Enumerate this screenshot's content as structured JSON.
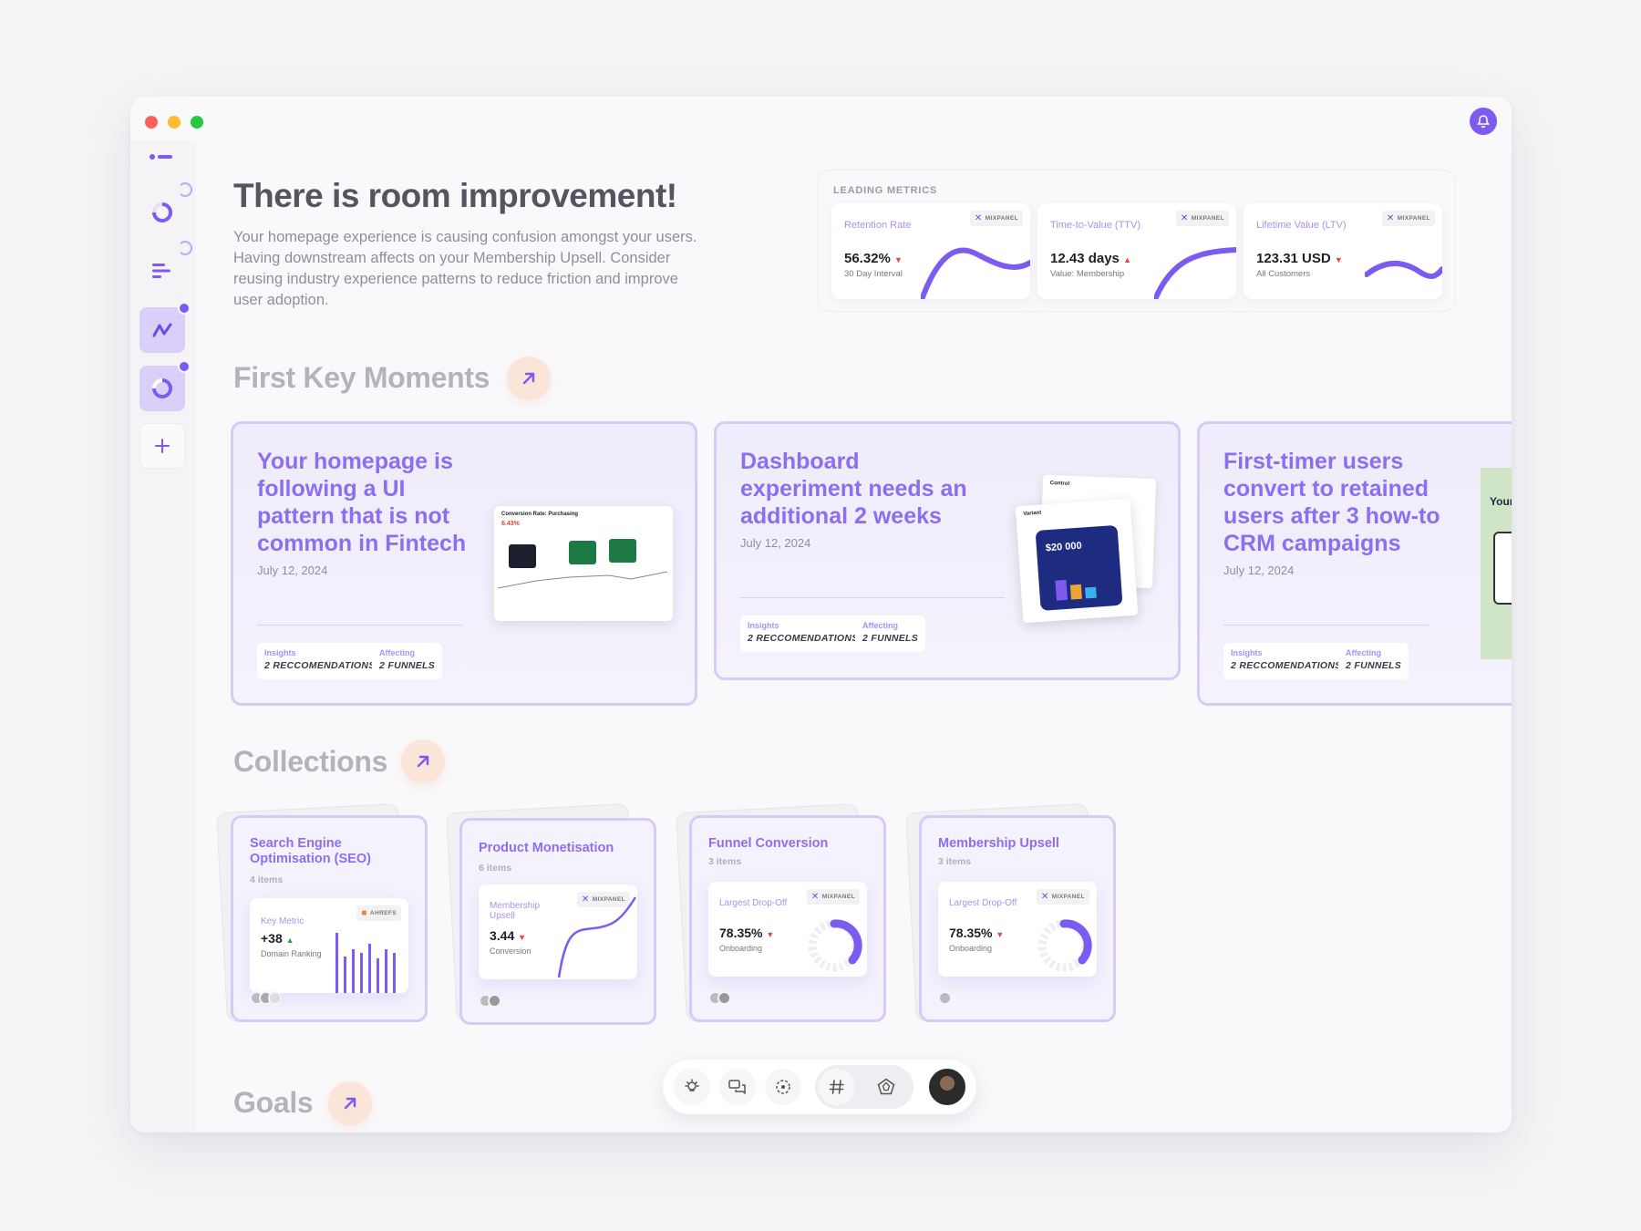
{
  "hero": {
    "title": "There is room improvement!",
    "description": "Your homepage experience is causing confusion amongst your users. Having downstream affects on your Membership Upsell. Consider reusing industry experience patterns to reduce friction and improve user adoption."
  },
  "leading_metrics": {
    "label": "LEADING METRICS",
    "cards": [
      {
        "label": "Retention Rate",
        "value": "56.32%",
        "sub": "30 Day Interval",
        "source": "MIXPANEL",
        "trend": "down"
      },
      {
        "label": "Time-to-Value (TTV)",
        "value": "12.43 days",
        "sub": "Value: Membership",
        "source": "MIXPANEL",
        "trend": "up"
      },
      {
        "label": "Lifetime Value (LTV)",
        "value": "123.31 USD",
        "sub": "All Customers",
        "source": "MIXPANEL",
        "trend": "down"
      }
    ]
  },
  "sections": {
    "first_key_moments": "First Key Moments",
    "collections": "Collections",
    "goals": "Goals"
  },
  "key_moments": [
    {
      "title": "Your homepage is following a UI pattern that is not common in Fintech",
      "date": "July 12, 2024",
      "insights_label": "Insights",
      "insights_value": "2 RECCOMENDATIONS",
      "affecting_label": "Affecting",
      "affecting_value": "2 FUNNELS",
      "preview_title": "Conversion Rate: Purchasing",
      "preview_value": "6.43%"
    },
    {
      "title": "Dashboard experiment needs an additional 2 weeks",
      "date": "July 12, 2024",
      "insights_label": "Insights",
      "insights_value": "2 RECCOMENDATIONS",
      "affecting_label": "Affecting",
      "affecting_value": "2 FUNNELS",
      "preview_control": "Control",
      "preview_variant": "Variant",
      "preview_amount": "$20 000"
    },
    {
      "title": "First-timer users convert to retained users after 3 how-to CRM campaigns",
      "date": "July 12, 2024",
      "insights_label": "Insights",
      "insights_value": "2 RECCOMENDATIONS",
      "affecting_label": "Affecting",
      "affecting_value": "2 FUNNELS",
      "preview_text": "Your"
    }
  ],
  "collections": [
    {
      "title": "Search Engine Optimisation (SEO)",
      "count": "4 items",
      "metric_label": "Key Metric",
      "metric_value": "+38",
      "metric_sub": "Domain Ranking",
      "source": "AHREFS",
      "trend": "up"
    },
    {
      "title": "Product Monetisation",
      "count": "6 items",
      "metric_label": "Membership Upsell",
      "metric_value": "3.44",
      "metric_sub": "Conversion",
      "source": "MIXPANEL",
      "trend": "down"
    },
    {
      "title": "Funnel Conversion",
      "count": "3 items",
      "metric_label": "Largest Drop-Off",
      "metric_value": "78.35%",
      "metric_sub": "Onboarding",
      "source": "MIXPANEL",
      "trend": "down"
    },
    {
      "title": "Membership Upsell",
      "count": "3 items",
      "metric_label": "Largest Drop-Off",
      "metric_value": "78.35%",
      "metric_sub": "Onboarding",
      "source": "MIXPANEL",
      "trend": "down"
    }
  ],
  "colors": {
    "accent": "#7c5cf0",
    "title_purple": "#8c6ef0",
    "down": "#e8433f",
    "up": "#21a55b"
  }
}
